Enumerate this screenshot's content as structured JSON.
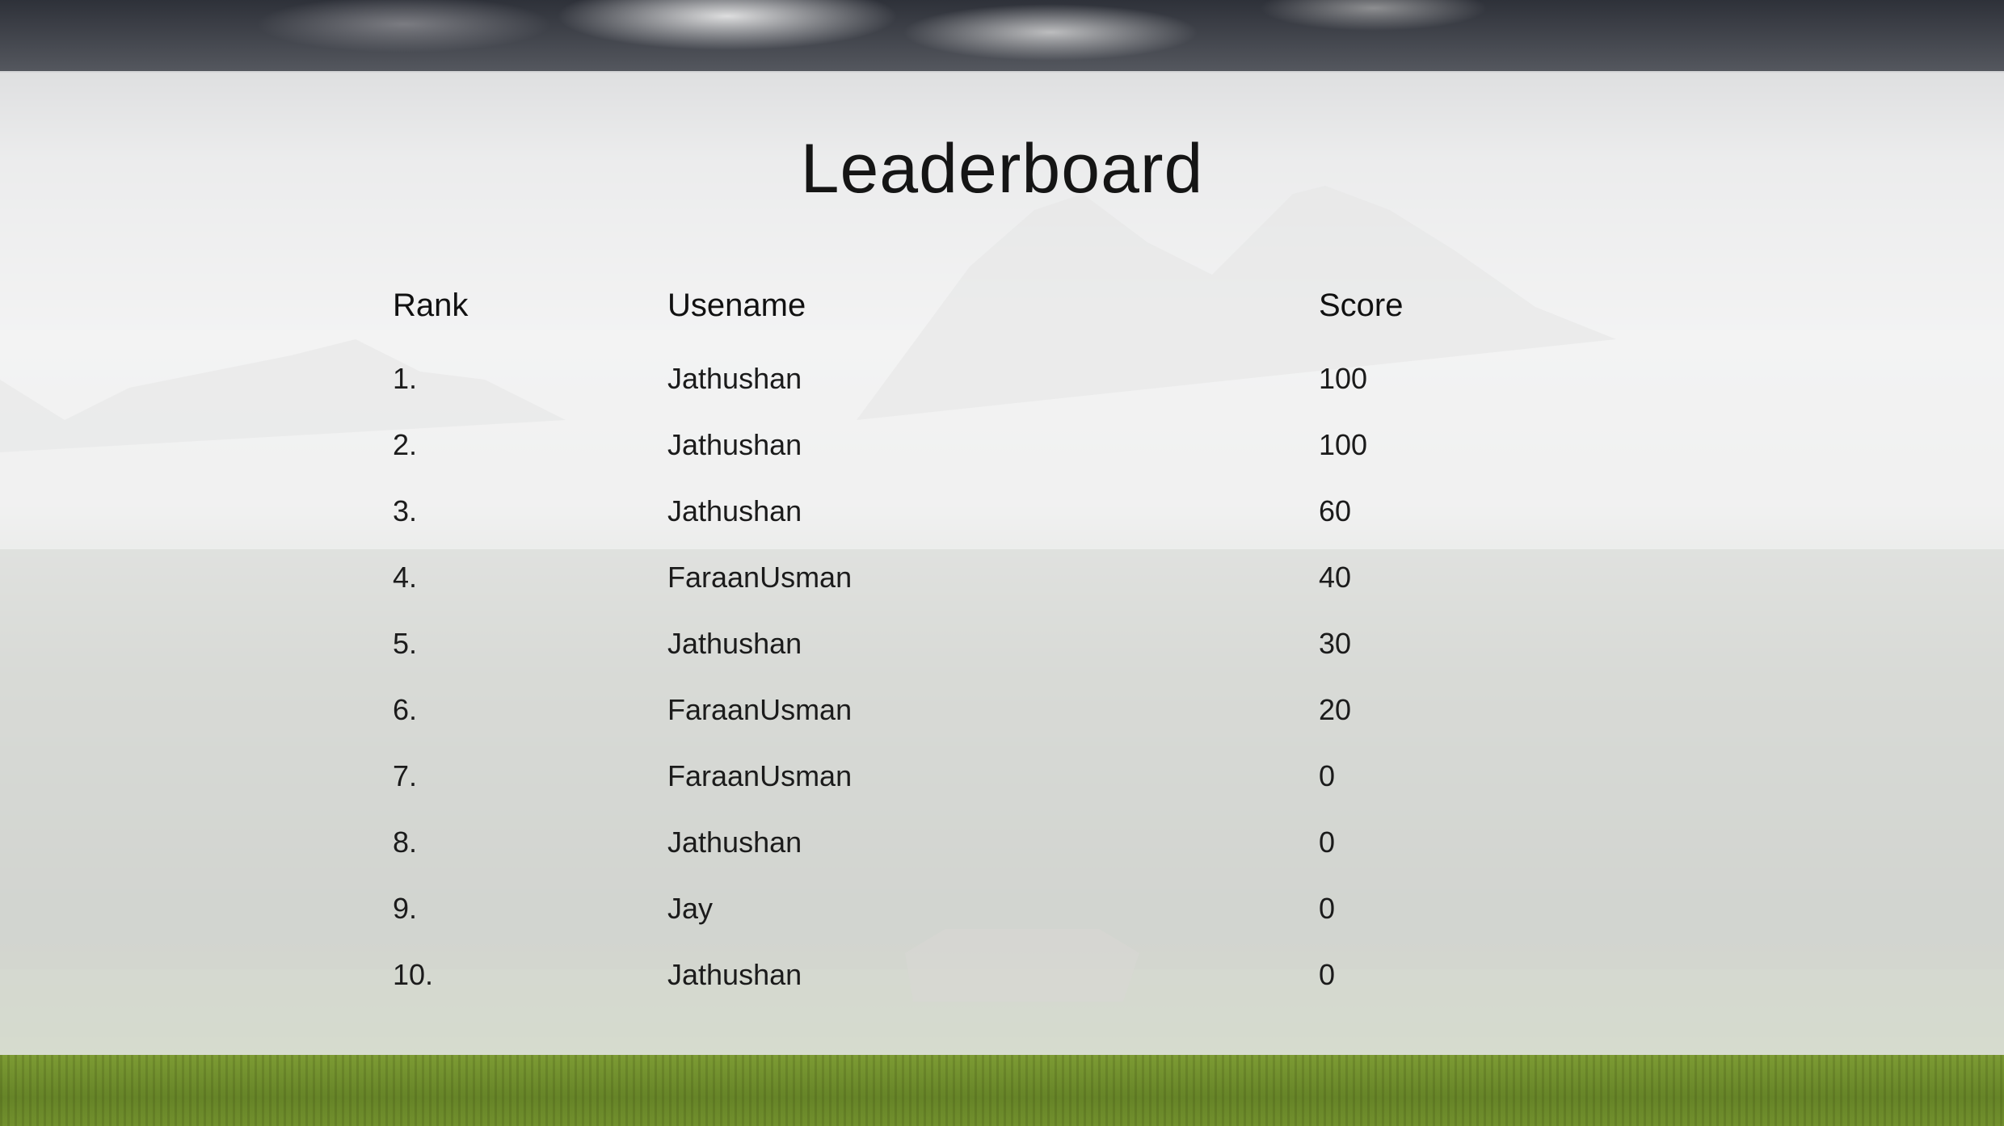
{
  "page": {
    "title": "Leaderboard"
  },
  "leaderboard": {
    "headers": {
      "rank": "Rank",
      "username": "Usename",
      "score": "Score"
    },
    "rows": [
      {
        "rank": "1.",
        "username": "Jathushan",
        "score": "100"
      },
      {
        "rank": "2.",
        "username": "Jathushan",
        "score": "100"
      },
      {
        "rank": "3.",
        "username": "Jathushan",
        "score": "60"
      },
      {
        "rank": "4.",
        "username": "FaraanUsman",
        "score": "40"
      },
      {
        "rank": "5.",
        "username": "Jathushan",
        "score": "30"
      },
      {
        "rank": "6.",
        "username": "FaraanUsman",
        "score": "20"
      },
      {
        "rank": "7.",
        "username": "FaraanUsman",
        "score": "0"
      },
      {
        "rank": "8.",
        "username": "Jathushan",
        "score": "0"
      },
      {
        "rank": "9.",
        "username": "Jay",
        "score": "0"
      },
      {
        "rank": "10.",
        "username": "Jathushan",
        "score": "0"
      }
    ]
  },
  "colors": {
    "panel": "#fafafa",
    "text": "#111111",
    "grass": "#6f8e2e",
    "sky": "#3b3f47"
  }
}
